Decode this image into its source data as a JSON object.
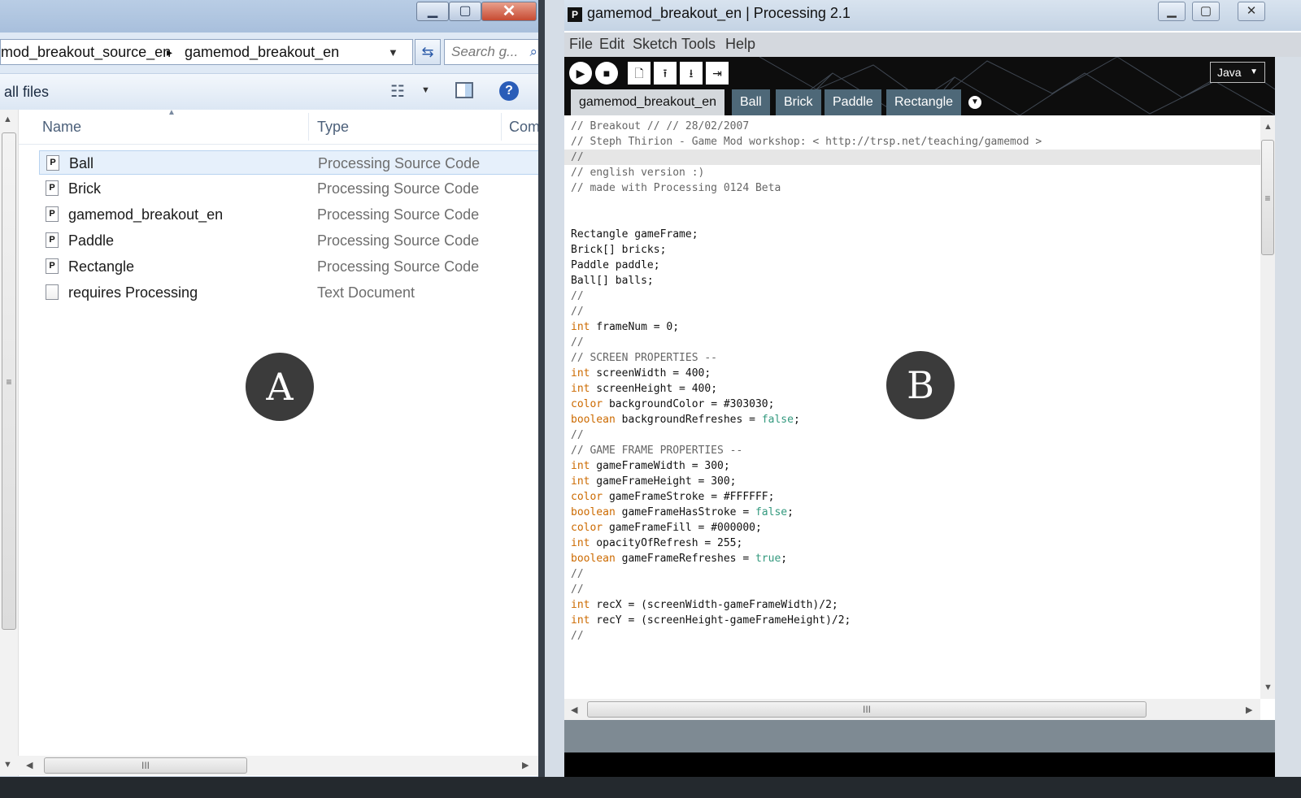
{
  "explorer": {
    "breadcrumb_parent": "mod_breakout_source_en",
    "breadcrumb_sep": "▸",
    "breadcrumb_current": "gamemod_breakout_en",
    "search_placeholder": "Search g...",
    "toolbar_label": "all files",
    "columns": {
      "name": "Name",
      "type": "Type",
      "comments": "Com"
    },
    "files": [
      {
        "name": "Ball",
        "type": "Processing Source Code",
        "icon": "processing-file-icon"
      },
      {
        "name": "Brick",
        "type": "Processing Source Code",
        "icon": "processing-file-icon"
      },
      {
        "name": "gamemod_breakout_en",
        "type": "Processing Source Code",
        "icon": "processing-file-icon"
      },
      {
        "name": "Paddle",
        "type": "Processing Source Code",
        "icon": "processing-file-icon"
      },
      {
        "name": "Rectangle",
        "type": "Processing Source Code",
        "icon": "processing-file-icon"
      },
      {
        "name": "requires Processing",
        "type": "Text Document",
        "icon": "text-file-icon"
      }
    ]
  },
  "processing": {
    "title": "gamemod_breakout_en | Processing 2.1",
    "menu": [
      "File",
      "Edit",
      "Sketch",
      "Tools",
      "Help"
    ],
    "mode": "Java",
    "tabs": [
      "gamemod_breakout_en",
      "Ball",
      "Brick",
      "Paddle",
      "Rectangle"
    ],
    "code": [
      "// Breakout // // 28/02/2007",
      "// Steph Thirion - Game Mod workshop: < http://trsp.net/teaching/gamemod >",
      "//",
      "// english version :)",
      "// made with Processing 0124 Beta",
      "",
      "",
      "Rectangle gameFrame;",
      "Brick[] bricks;",
      "Paddle paddle;",
      "Ball[] balls;",
      "//",
      "//",
      "int frameNum = 0;",
      "//",
      "// SCREEN PROPERTIES --",
      "int screenWidth = 400;",
      "int screenHeight = 400;",
      "color backgroundColor = #303030;",
      "boolean backgroundRefreshes = false;",
      "//",
      "// GAME FRAME PROPERTIES --",
      "int gameFrameWidth = 300;",
      "int gameFrameHeight = 300;",
      "color gameFrameStroke = #FFFFFF;",
      "boolean gameFrameHasStroke = false;",
      "color gameFrameFill = #000000;",
      "int opacityOfRefresh = 255;",
      "boolean gameFrameRefreshes = true;",
      "//",
      "//",
      "int recX = (screenWidth-gameFrameWidth)/2;",
      "int recY = (screenHeight-gameFrameHeight)/2;",
      "//"
    ]
  },
  "badges": {
    "a": "A",
    "b": "B"
  },
  "colors": {
    "keyword": "#cc6a00",
    "literal": "#33997e",
    "comment": "#666666",
    "tab": "#4e6878"
  }
}
